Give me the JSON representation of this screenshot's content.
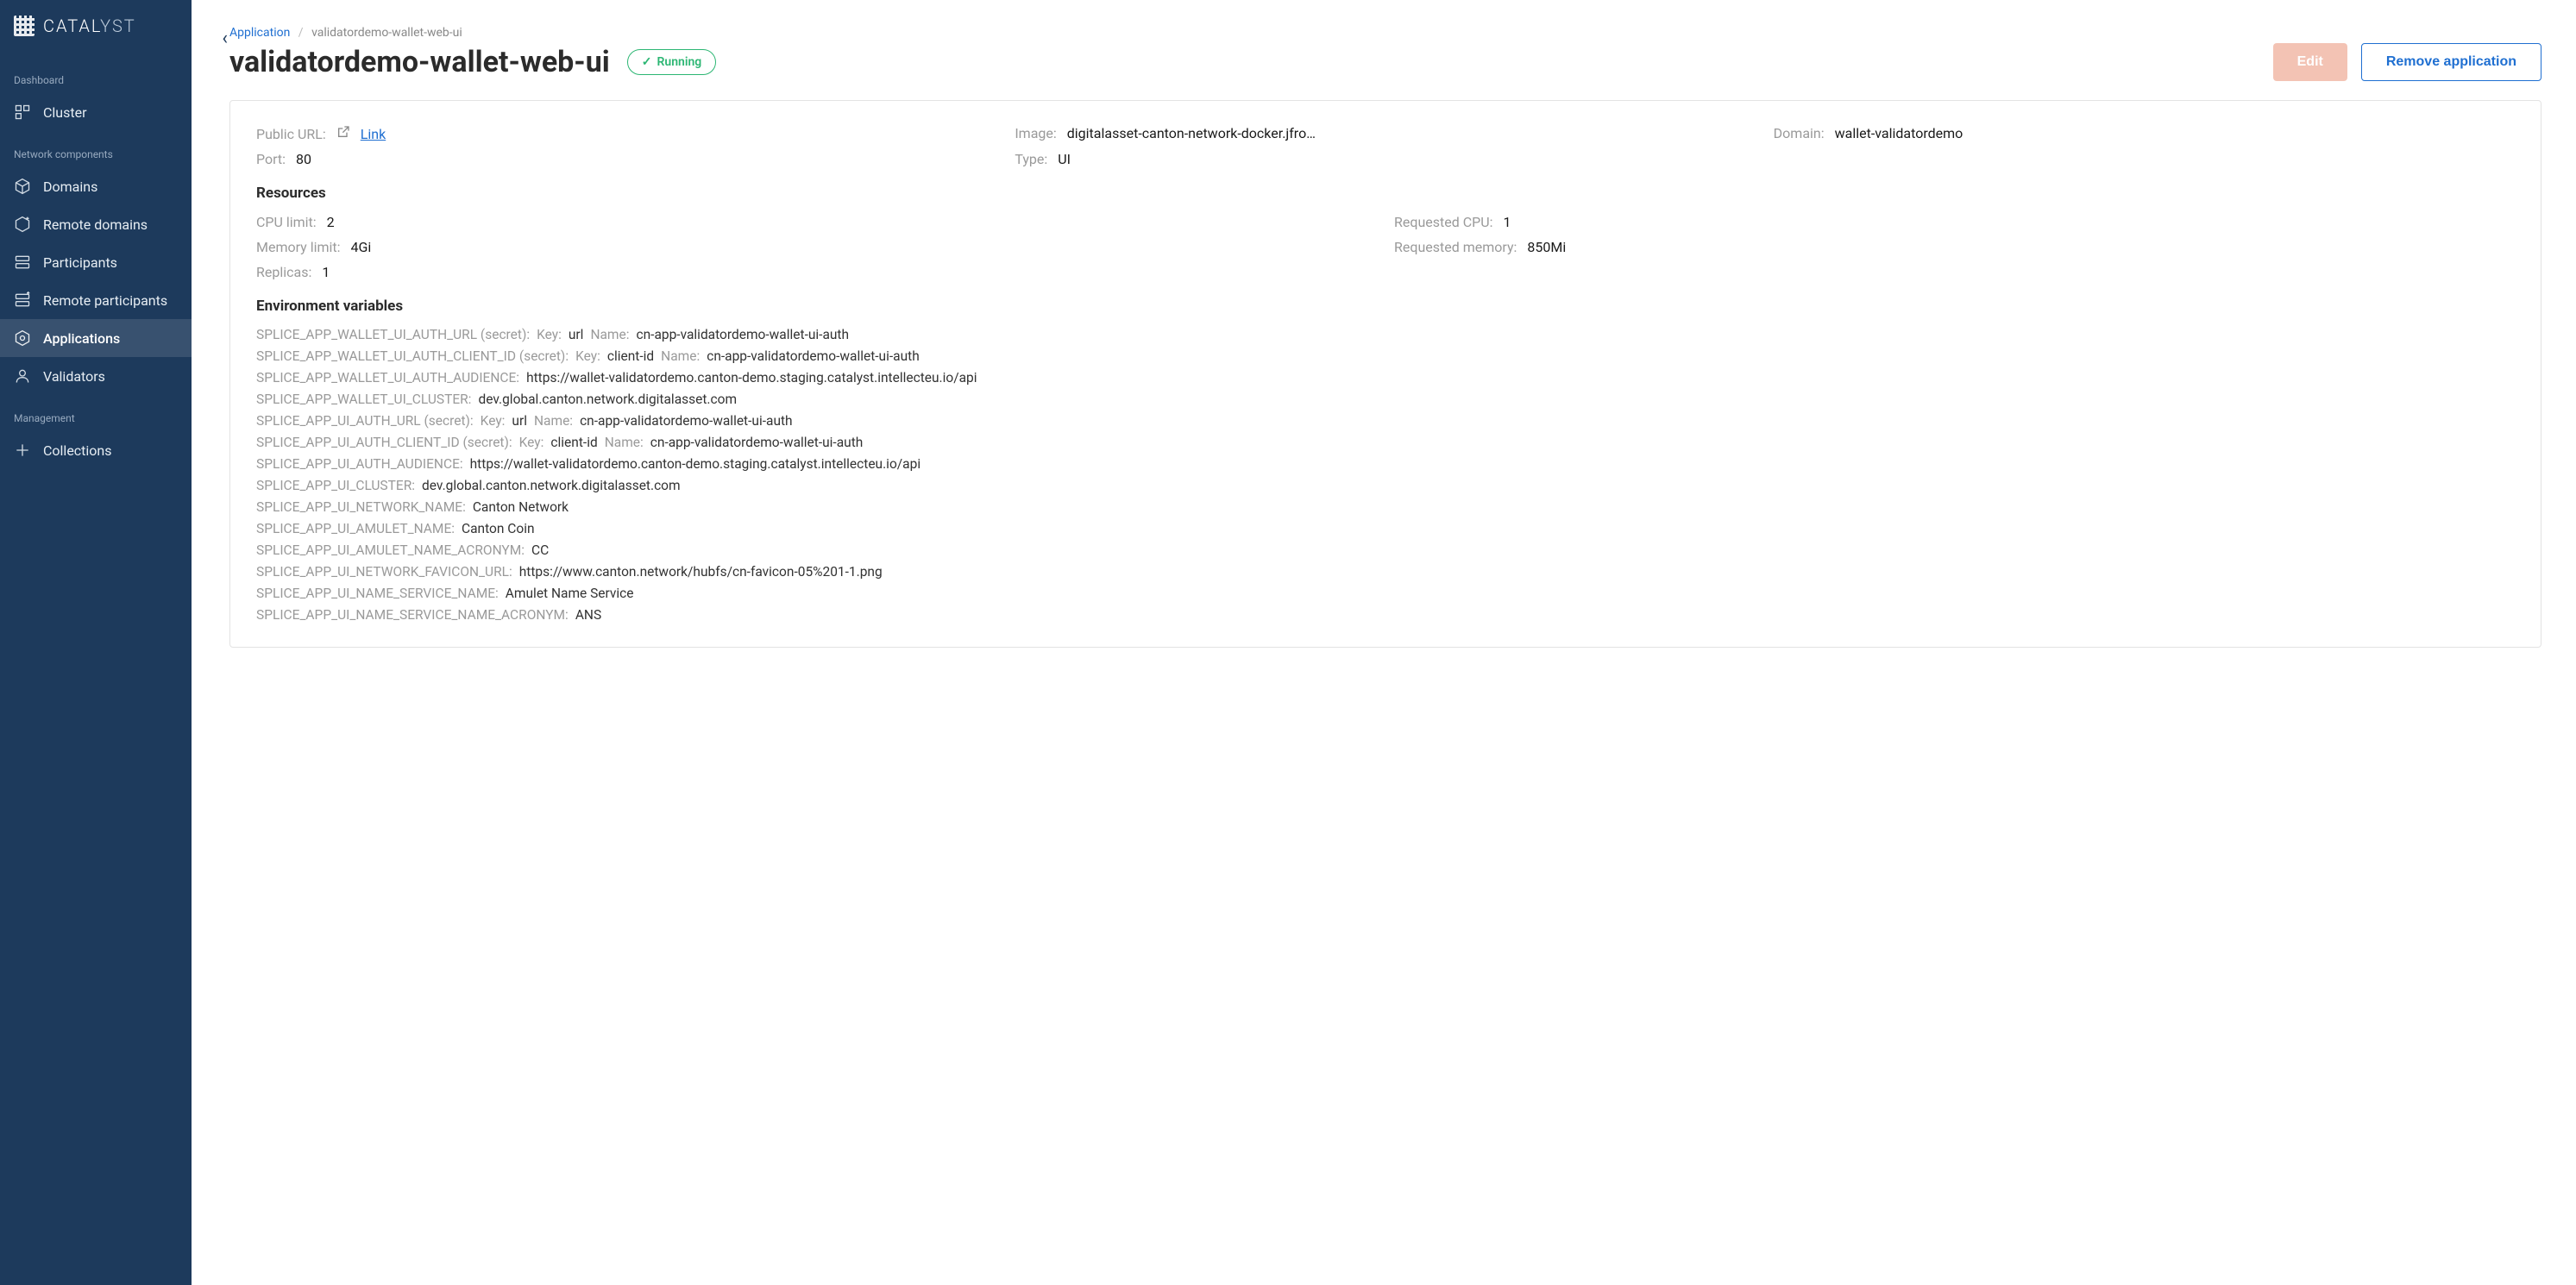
{
  "brand": {
    "name_prefix": "CATAL",
    "name_suffix": "YST"
  },
  "sidebar": {
    "dashboard_label": "Dashboard",
    "network_label": "Network components",
    "management_label": "Management",
    "items": {
      "cluster": "Cluster",
      "domains": "Domains",
      "remote_domains": "Remote domains",
      "participants": "Participants",
      "remote_participants": "Remote participants",
      "applications": "Applications",
      "validators": "Validators",
      "collections": "Collections"
    }
  },
  "breadcrumb": {
    "root": "Application",
    "current": "validatordemo-wallet-web-ui"
  },
  "header": {
    "title": "validatordemo-wallet-web-ui",
    "status": "Running",
    "edit": "Edit",
    "remove": "Remove application"
  },
  "info": {
    "public_url_label": "Public URL:",
    "link_text": "Link",
    "image_label": "Image:",
    "image_value": "digitalasset-canton-network-docker.jfrog.i…",
    "domain_label": "Domain:",
    "domain_value": "wallet-validatordemo",
    "port_label": "Port:",
    "port_value": "80",
    "type_label": "Type:",
    "type_value": "UI"
  },
  "resources": {
    "heading": "Resources",
    "cpu_limit_label": "CPU limit:",
    "cpu_limit_value": "2",
    "requested_cpu_label": "Requested CPU:",
    "requested_cpu_value": "1",
    "memory_limit_label": "Memory limit:",
    "memory_limit_value": "4Gi",
    "requested_memory_label": "Requested memory:",
    "requested_memory_value": "850Mi",
    "replicas_label": "Replicas:",
    "replicas_value": "1"
  },
  "env": {
    "heading": "Environment variables",
    "key_label": "Key:",
    "name_label": "Name:",
    "vars": [
      {
        "name": "SPLICE_APP_WALLET_UI_AUTH_URL (secret):",
        "secret": true,
        "key": "url",
        "secret_name": "cn-app-validatordemo-wallet-ui-auth"
      },
      {
        "name": "SPLICE_APP_WALLET_UI_AUTH_CLIENT_ID (secret):",
        "secret": true,
        "key": "client-id",
        "secret_name": "cn-app-validatordemo-wallet-ui-auth"
      },
      {
        "name": "SPLICE_APP_WALLET_UI_AUTH_AUDIENCE:",
        "secret": false,
        "value": "https://wallet-validatordemo.canton-demo.staging.catalyst.intellecteu.io/api"
      },
      {
        "name": "SPLICE_APP_WALLET_UI_CLUSTER:",
        "secret": false,
        "value": "dev.global.canton.network.digitalasset.com"
      },
      {
        "name": "SPLICE_APP_UI_AUTH_URL (secret):",
        "secret": true,
        "key": "url",
        "secret_name": "cn-app-validatordemo-wallet-ui-auth"
      },
      {
        "name": "SPLICE_APP_UI_AUTH_CLIENT_ID (secret):",
        "secret": true,
        "key": "client-id",
        "secret_name": "cn-app-validatordemo-wallet-ui-auth"
      },
      {
        "name": "SPLICE_APP_UI_AUTH_AUDIENCE:",
        "secret": false,
        "value": "https://wallet-validatordemo.canton-demo.staging.catalyst.intellecteu.io/api"
      },
      {
        "name": "SPLICE_APP_UI_CLUSTER:",
        "secret": false,
        "value": "dev.global.canton.network.digitalasset.com"
      },
      {
        "name": "SPLICE_APP_UI_NETWORK_NAME:",
        "secret": false,
        "value": "Canton Network"
      },
      {
        "name": "SPLICE_APP_UI_AMULET_NAME:",
        "secret": false,
        "value": "Canton Coin"
      },
      {
        "name": "SPLICE_APP_UI_AMULET_NAME_ACRONYM:",
        "secret": false,
        "value": "CC"
      },
      {
        "name": "SPLICE_APP_UI_NETWORK_FAVICON_URL:",
        "secret": false,
        "value": "https://www.canton.network/hubfs/cn-favicon-05%201-1.png"
      },
      {
        "name": "SPLICE_APP_UI_NAME_SERVICE_NAME:",
        "secret": false,
        "value": "Amulet Name Service"
      },
      {
        "name": "SPLICE_APP_UI_NAME_SERVICE_NAME_ACRONYM:",
        "secret": false,
        "value": "ANS"
      }
    ]
  }
}
